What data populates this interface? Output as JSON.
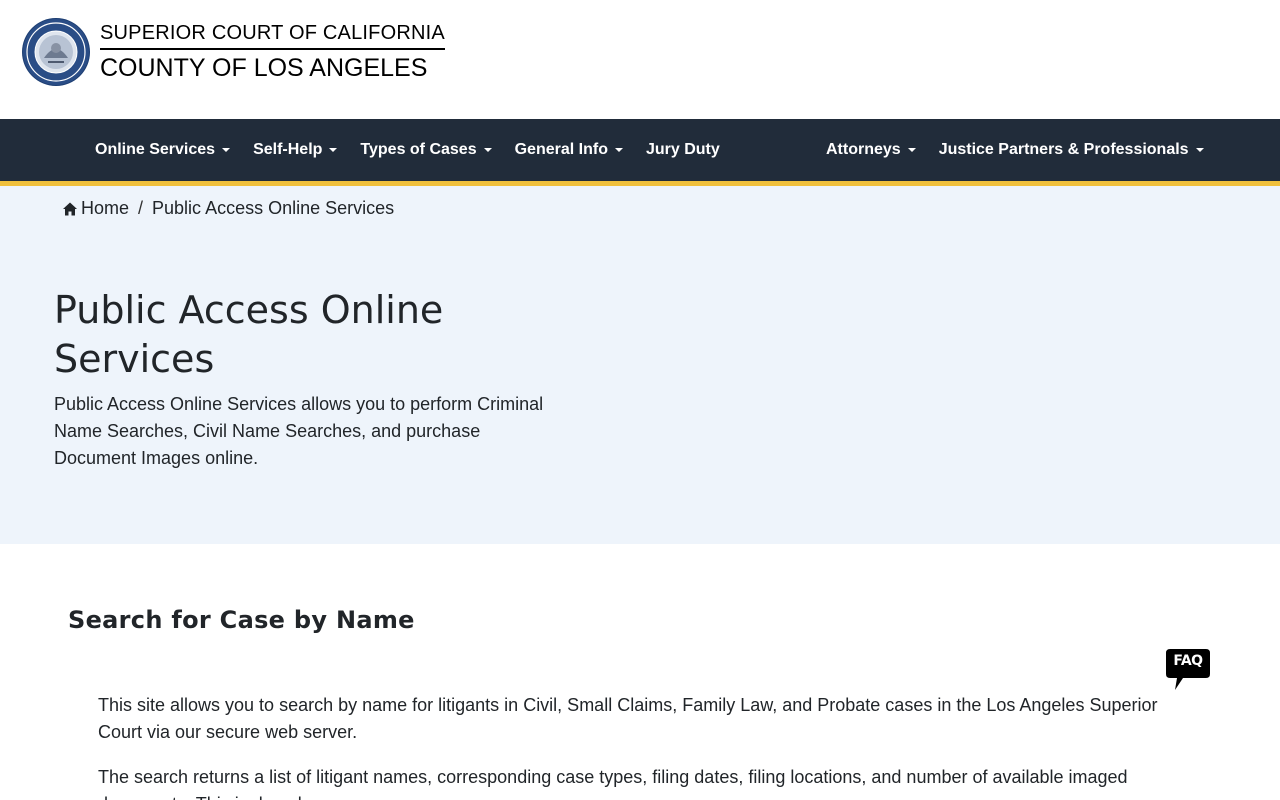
{
  "header": {
    "court_line1": "SUPERIOR COURT OF CALIFORNIA",
    "court_line2": "COUNTY OF LOS ANGELES",
    "seal_icon": "court-seal-icon"
  },
  "nav": {
    "left_items": [
      {
        "label": "Online Services",
        "dropdown": true
      },
      {
        "label": "Self-Help",
        "dropdown": true
      },
      {
        "label": "Types of Cases",
        "dropdown": true
      },
      {
        "label": "General Info",
        "dropdown": true
      },
      {
        "label": "Jury Duty",
        "dropdown": false
      }
    ],
    "right_items": [
      {
        "label": "Attorneys",
        "dropdown": true
      },
      {
        "label": "Justice Partners & Professionals",
        "dropdown": true
      }
    ],
    "background_color": "#212c3a",
    "accent_color": "#f0c03c"
  },
  "breadcrumb": {
    "home_label": "Home",
    "separator": "/",
    "current": "Public Access Online Services"
  },
  "hero": {
    "title": "Public Access Online Services",
    "intro": "Public Access Online Services allows you to perform Criminal Name Searches, Civil Name Searches, and purchase Document Images online.",
    "background_color": "#eef4fb"
  },
  "section": {
    "title": "Search for Case by Name",
    "faq_label": "FAQ",
    "paragraphs": [
      "This site allows you to search by name for litigants in Civil, Small Claims, Family Law, and Probate cases in the Los Angeles Superior Court via our secure web server.",
      "The search returns a list of litigant names, corresponding case types, filing dates, filing locations, and number of available imaged documents. This is done by…"
    ]
  }
}
